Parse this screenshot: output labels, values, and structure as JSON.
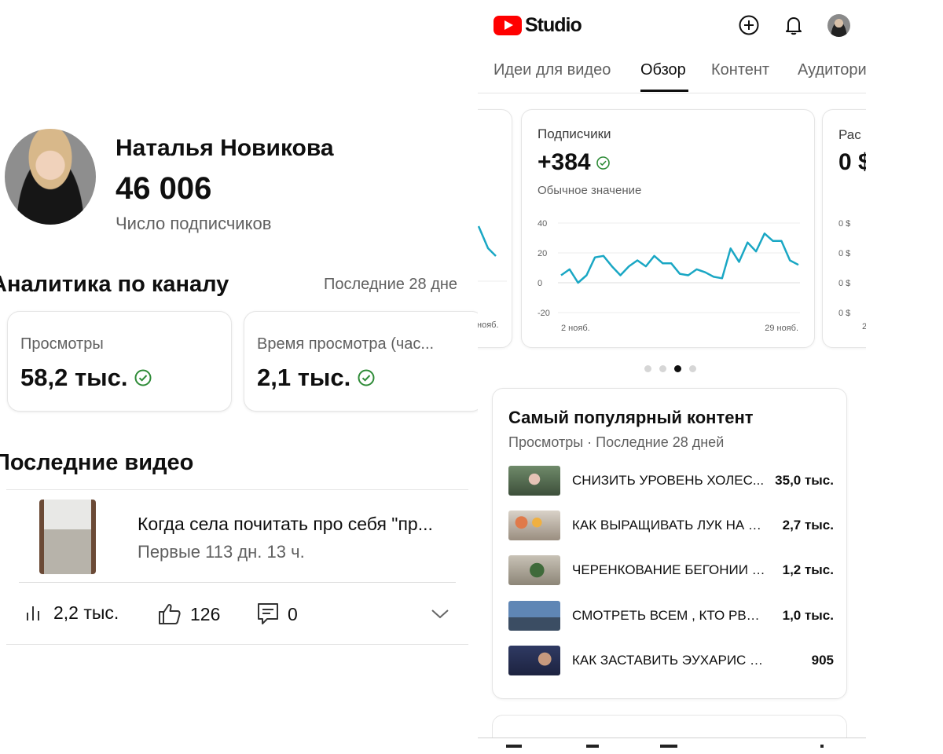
{
  "left": {
    "channel": {
      "name": "Наталья Новикова",
      "subscribers": "46 006",
      "subscribers_label": "Число подписчиков"
    },
    "analytics": {
      "title": "Аналитика по каналу",
      "period": "Последние 28 дне",
      "cards": [
        {
          "label": "Просмотры",
          "value": "58,2 тыс."
        },
        {
          "label": "Время просмотра (час...",
          "value": "2,1 тыс."
        }
      ]
    },
    "recent": {
      "title": "Последние видео",
      "video": {
        "title": "Когда села почитать про себя \"пр...",
        "subtitle": "Первые 113 дн. 13 ч.",
        "views": "2,2 тыс.",
        "likes": "126",
        "comments": "0"
      }
    }
  },
  "right": {
    "app_name": "Studio",
    "tabs": [
      "Идеи для видео",
      "Обзор",
      "Контент",
      "Аудитори"
    ],
    "active_tab": "Обзор",
    "cards": {
      "prev_x_label": "нояб.",
      "next_title": "Рас",
      "next_value": "0 $",
      "next_ticks": [
        "0 $",
        "0 $",
        "0 $",
        "0 $"
      ],
      "next_x_label": "2"
    },
    "subscribers_card": {
      "title": "Подписчики",
      "value": "+384",
      "note": "Обычное значение"
    },
    "popular": {
      "title": "Самый популярный контент",
      "subtitle": "Просмотры · Последние 28 дней",
      "items": [
        {
          "title": "СНИЗИТЬ УРОВЕНЬ ХОЛЕС...",
          "views": "35,0 тыс."
        },
        {
          "title": "КАК ВЫРАЩИВАТЬ ЛУК НА З...",
          "views": "2,7 тыс."
        },
        {
          "title": "ЧЕРЕНКОВАНИЕ БЕГОНИИ 1...",
          "views": "1,2 тыс."
        },
        {
          "title": "СМОТРЕТЬ  ВСЕМ , КТО РВЁТ...",
          "views": "1,0 тыс."
        },
        {
          "title": "КАК ЗАСТАВИТЬ ЭУХАРИС Ц...",
          "views": "905"
        }
      ]
    },
    "colors": {
      "line": "#1aa7c4",
      "check": "#2e8b37",
      "brand": "#ff0000"
    }
  },
  "chart_data": {
    "type": "line",
    "title": "",
    "x": [
      1,
      2,
      3,
      4,
      5,
      6,
      7,
      8,
      9,
      10,
      11,
      12,
      13,
      14,
      15,
      16,
      17,
      18,
      19,
      20,
      21,
      22,
      23,
      24,
      25,
      26,
      27,
      28,
      29
    ],
    "x_tick_labels": [
      "2 нояб.",
      "29 нояб."
    ],
    "series": [
      {
        "values": [
          5,
          9,
          0,
          5,
          17,
          18,
          11,
          5,
          11,
          15,
          11,
          18,
          13,
          13,
          6,
          5,
          9,
          7,
          4,
          3,
          23,
          14,
          27,
          21,
          33,
          28,
          28,
          15,
          12
        ]
      }
    ],
    "ylim": [
      -20,
      40
    ],
    "yticks": [
      40,
      20,
      0,
      -20
    ],
    "grid": true
  }
}
